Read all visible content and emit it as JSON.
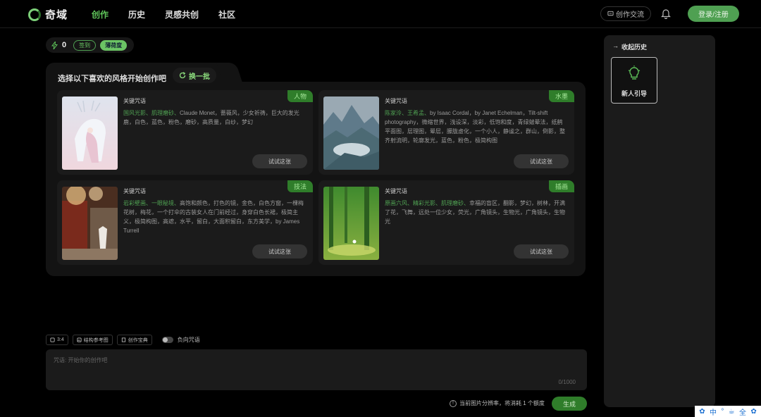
{
  "header": {
    "logo_text": "奇域",
    "nav": [
      "创作",
      "历史",
      "灵感共创",
      "社区"
    ],
    "creation_exchange": "创作交流",
    "login": "登录/注册"
  },
  "credit": {
    "value": "0",
    "checkin": "签到",
    "guide": "薄荷度"
  },
  "panel": {
    "title": "选择以下喜欢的风格开始创作吧",
    "refresh": "换一批",
    "cards": [
      {
        "tag": "人物",
        "label": "关键咒语",
        "highlight": "国风光影、肌理磨砂、",
        "text": "Claude Monet，蔷薇风，少女祈祷，巨大的发光鹿，白色，蓝色，粉色，磨砂，高质量，白纱，梦幻",
        "button": "试试这张"
      },
      {
        "tag": "水墨",
        "label": "关键咒语",
        "highlight": "陈家泠、王希孟、",
        "text": "by Isaac Cordal，by Janet Echelman，Tilt-shift photography，微缩世界，浅设深，淡彩，低饱和度，青绿皴晕法，纸鹤平面图，层理图，晕层，朦胧虚化，一个小人，静谧之，群山，倒影，整齐射流明，轮廓发光，蓝色，粉色，极简构图",
        "button": "试试这张"
      },
      {
        "tag": "技法",
        "label": "关键咒语",
        "highlight": "岩彩壁画、一眼秘境、",
        "text": "高饱和颜色，打色的镜，金色，白色方窗，一棵梅花树，梅花，一个打伞的古装女人在门前经过，身穿白色长裙，极简主义，极简构图，高遮，水平，留白，大面积留白，东方美学，by James Turrell",
        "button": "试试这张"
      },
      {
        "tag": "插画",
        "label": "关键咒语",
        "highlight": "原画六风、精彩光影、肌理磨砂、",
        "text": "幸福的盲区，翻影，梦幻，树林，开满了花，飞舞，远处一位少女，荧光，广角镜头，生物光，广角镜头，生物光",
        "button": "试试这张"
      }
    ]
  },
  "options": [
    "3:4",
    "结构参考图",
    "创作宝典"
  ],
  "negative_prompt": "负向咒语",
  "prompt": {
    "placeholder": "咒语: 开始你的创作吧",
    "count": "0/1000"
  },
  "hint": "当前图片分辨率，将消耗 1 个额度",
  "generate": "生成",
  "sidebar": {
    "title": "收起历史",
    "card_label": "新人引导"
  },
  "ime": [
    "中",
    "°",
    "☕",
    "全",
    "✿"
  ]
}
